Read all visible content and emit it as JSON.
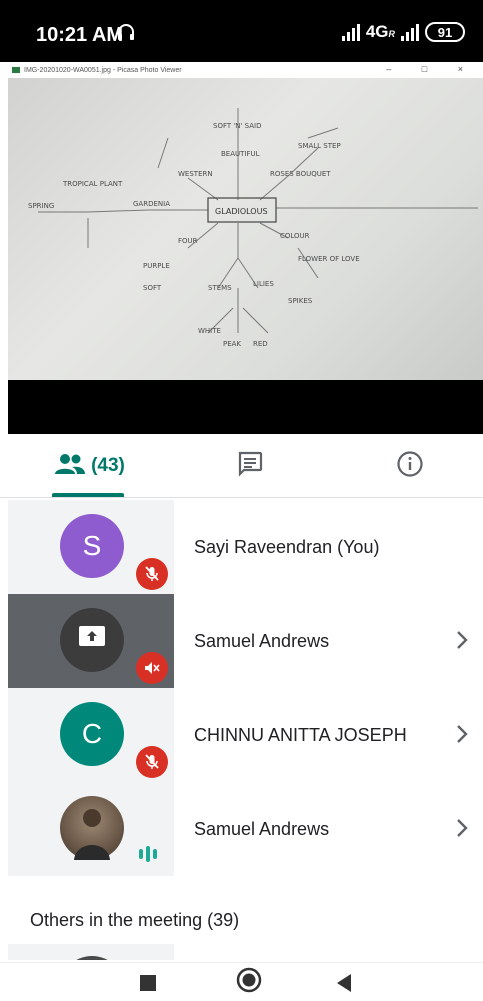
{
  "status_bar": {
    "time": "10:21 AM",
    "network": "4G",
    "network_sub": "R",
    "battery": "91"
  },
  "viewer": {
    "title": "IMG-20201020-WA0051.jpg - Picasa Photo Viewer",
    "controls": "– □ ×"
  },
  "whiteboard": {
    "center": "GLADIOLOUS",
    "words": [
      "SOFT 'N' SAID",
      "BEAUTIFUL",
      "WESTERN",
      "TROPICAL PLANT",
      "SPRING",
      "GARDENIA",
      "SMALL STEP",
      "FOUR",
      "PURPLE",
      "SOFT",
      "WHITE",
      "STEMS",
      "SPIKES",
      "ROSES BOUQUET",
      "COLOUR",
      "FLOWER OF LOVE",
      "LILIES",
      "PEAK",
      "RED"
    ]
  },
  "tabs": {
    "people_count": "(43)",
    "people_icon": "people-icon",
    "chat_icon": "chat-icon",
    "info_icon": "info-icon",
    "active_color": "#00796b"
  },
  "participants": [
    {
      "name": "Sayi Raveendran (You)",
      "initial": "S",
      "avatar_color": "#8e5ccf",
      "mic": "muted"
    },
    {
      "name": "Samuel Andrews",
      "initial": "",
      "avatar_color": "#3c3c3c",
      "mic": "muted",
      "presenting": true
    },
    {
      "name": "CHINNU ANITTA JOSEPH",
      "initial": "C",
      "avatar_color": "#00897b",
      "mic": "muted"
    },
    {
      "name": "Samuel Andrews",
      "initial": "",
      "avatar_color": "#6d5a4a",
      "mic": "speaking"
    }
  ],
  "others_title": "Others in the meeting (39)",
  "colors": {
    "muted_badge": "#d93025",
    "speaking": "#1ea896"
  }
}
